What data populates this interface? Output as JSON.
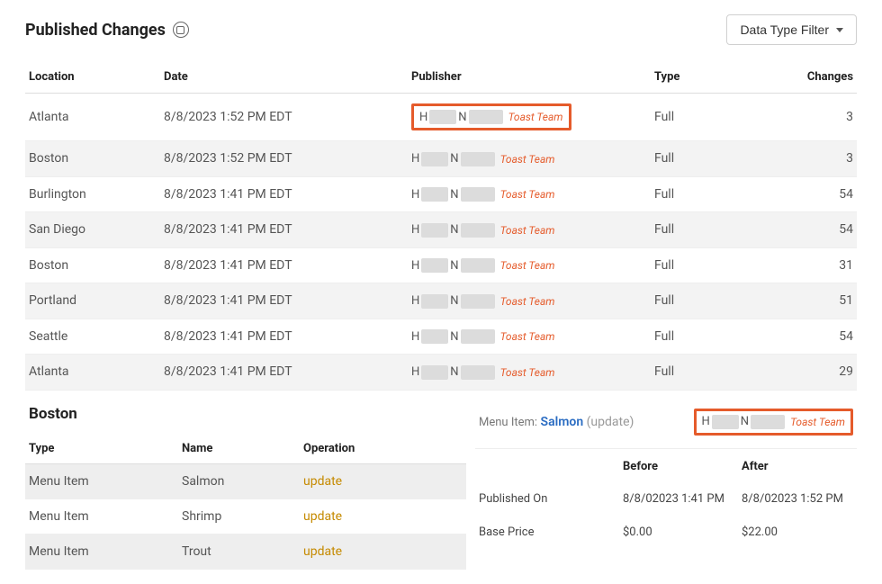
{
  "header": {
    "title": "Published Changes",
    "filter_label": "Data Type Filter"
  },
  "columns": {
    "location": "Location",
    "date": "Date",
    "publisher": "Publisher",
    "type": "Type",
    "changes": "Changes"
  },
  "publisher_common": {
    "initial1": "H",
    "initial2": "N",
    "team": "Toast Team"
  },
  "rows": [
    {
      "location": "Atlanta",
      "date": "8/8/2023 1:52 PM EDT",
      "type": "Full",
      "changes": "3",
      "highlight": true
    },
    {
      "location": "Boston",
      "date": "8/8/2023 1:52 PM EDT",
      "type": "Full",
      "changes": "3",
      "highlight": false
    },
    {
      "location": "Burlington",
      "date": "8/8/2023 1:41 PM EDT",
      "type": "Full",
      "changes": "54",
      "highlight": false
    },
    {
      "location": "San Diego",
      "date": "8/8/2023 1:41 PM EDT",
      "type": "Full",
      "changes": "54",
      "highlight": false
    },
    {
      "location": "Boston",
      "date": "8/8/2023 1:41 PM EDT",
      "type": "Full",
      "changes": "31",
      "highlight": false
    },
    {
      "location": "Portland",
      "date": "8/8/2023 1:41 PM EDT",
      "type": "Full",
      "changes": "51",
      "highlight": false
    },
    {
      "location": "Seattle",
      "date": "8/8/2023 1:41 PM EDT",
      "type": "Full",
      "changes": "54",
      "highlight": false
    },
    {
      "location": "Atlanta",
      "date": "8/8/2023 1:41 PM EDT",
      "type": "Full",
      "changes": "29",
      "highlight": false
    }
  ],
  "detail_section": {
    "title": "Boston",
    "cols": {
      "type": "Type",
      "name": "Name",
      "operation": "Operation"
    },
    "items": [
      {
        "type": "Menu Item",
        "name": "Salmon",
        "op": "update"
      },
      {
        "type": "Menu Item",
        "name": "Shrimp",
        "op": "update"
      },
      {
        "type": "Menu Item",
        "name": "Trout",
        "op": "update"
      }
    ]
  },
  "compare": {
    "prefix": "Menu Item:",
    "name": "Salmon",
    "suffix": "(update)",
    "cols": {
      "before": "Before",
      "after": "After"
    },
    "rows": [
      {
        "label": "Published On",
        "before": "8/8/02023 1:41 PM",
        "after": "8/8/02023 1:52 PM"
      },
      {
        "label": "Base Price",
        "before": "$0.00",
        "after": "$22.00"
      }
    ]
  }
}
